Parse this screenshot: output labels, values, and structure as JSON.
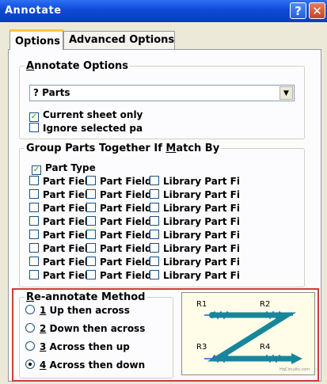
{
  "window": {
    "title": "Annotate",
    "help_glyph": "?",
    "close_glyph": "✕"
  },
  "tabs": [
    {
      "label": "Options"
    },
    {
      "label": "Advanced Options"
    }
  ],
  "annotate_options": {
    "legend": "Annotate Options",
    "combo_value": "? Parts",
    "combo_arrow": "▼",
    "current_sheet_only": {
      "label": "Current sheet only",
      "checked": true
    },
    "ignore_selected": {
      "label": "Ignore selected pa",
      "checked": false
    }
  },
  "group_parts": {
    "legend": "Group Parts Together If Match By",
    "part_type": {
      "label": "Part Type",
      "checked": true
    },
    "rows": [
      [
        "Part Field",
        "Part Field",
        "Library Part Fi"
      ],
      [
        "Part Field",
        "Part Field",
        "Library Part Fi"
      ],
      [
        "Part Field",
        "Part Field",
        "Library Part Fi"
      ],
      [
        "Part Field",
        "Part Field",
        "Library Part Fi"
      ],
      [
        "Part Field",
        "Part Field",
        "Library Part Fi"
      ],
      [
        "Part Field",
        "Part Field",
        "Library Part Fi"
      ],
      [
        "Part Field",
        "Part Field",
        "Library Part Fi"
      ],
      [
        "Part Field",
        "Part Field",
        "Library Part Fi"
      ]
    ]
  },
  "reannotate": {
    "legend": "Re-annotate Method",
    "options": [
      {
        "key": "1",
        "rest": " Up then across",
        "selected": false
      },
      {
        "key": "2",
        "rest": " Down then across",
        "selected": false
      },
      {
        "key": "3",
        "rest": " Across then up",
        "selected": false
      },
      {
        "key": "4",
        "rest": " Across then down",
        "selected": true
      }
    ]
  },
  "diagram": {
    "labels": [
      "R1",
      "R2",
      "R3",
      "R4"
    ],
    "watermark": "HqCircuits.com"
  },
  "check_glyph": "✓"
}
